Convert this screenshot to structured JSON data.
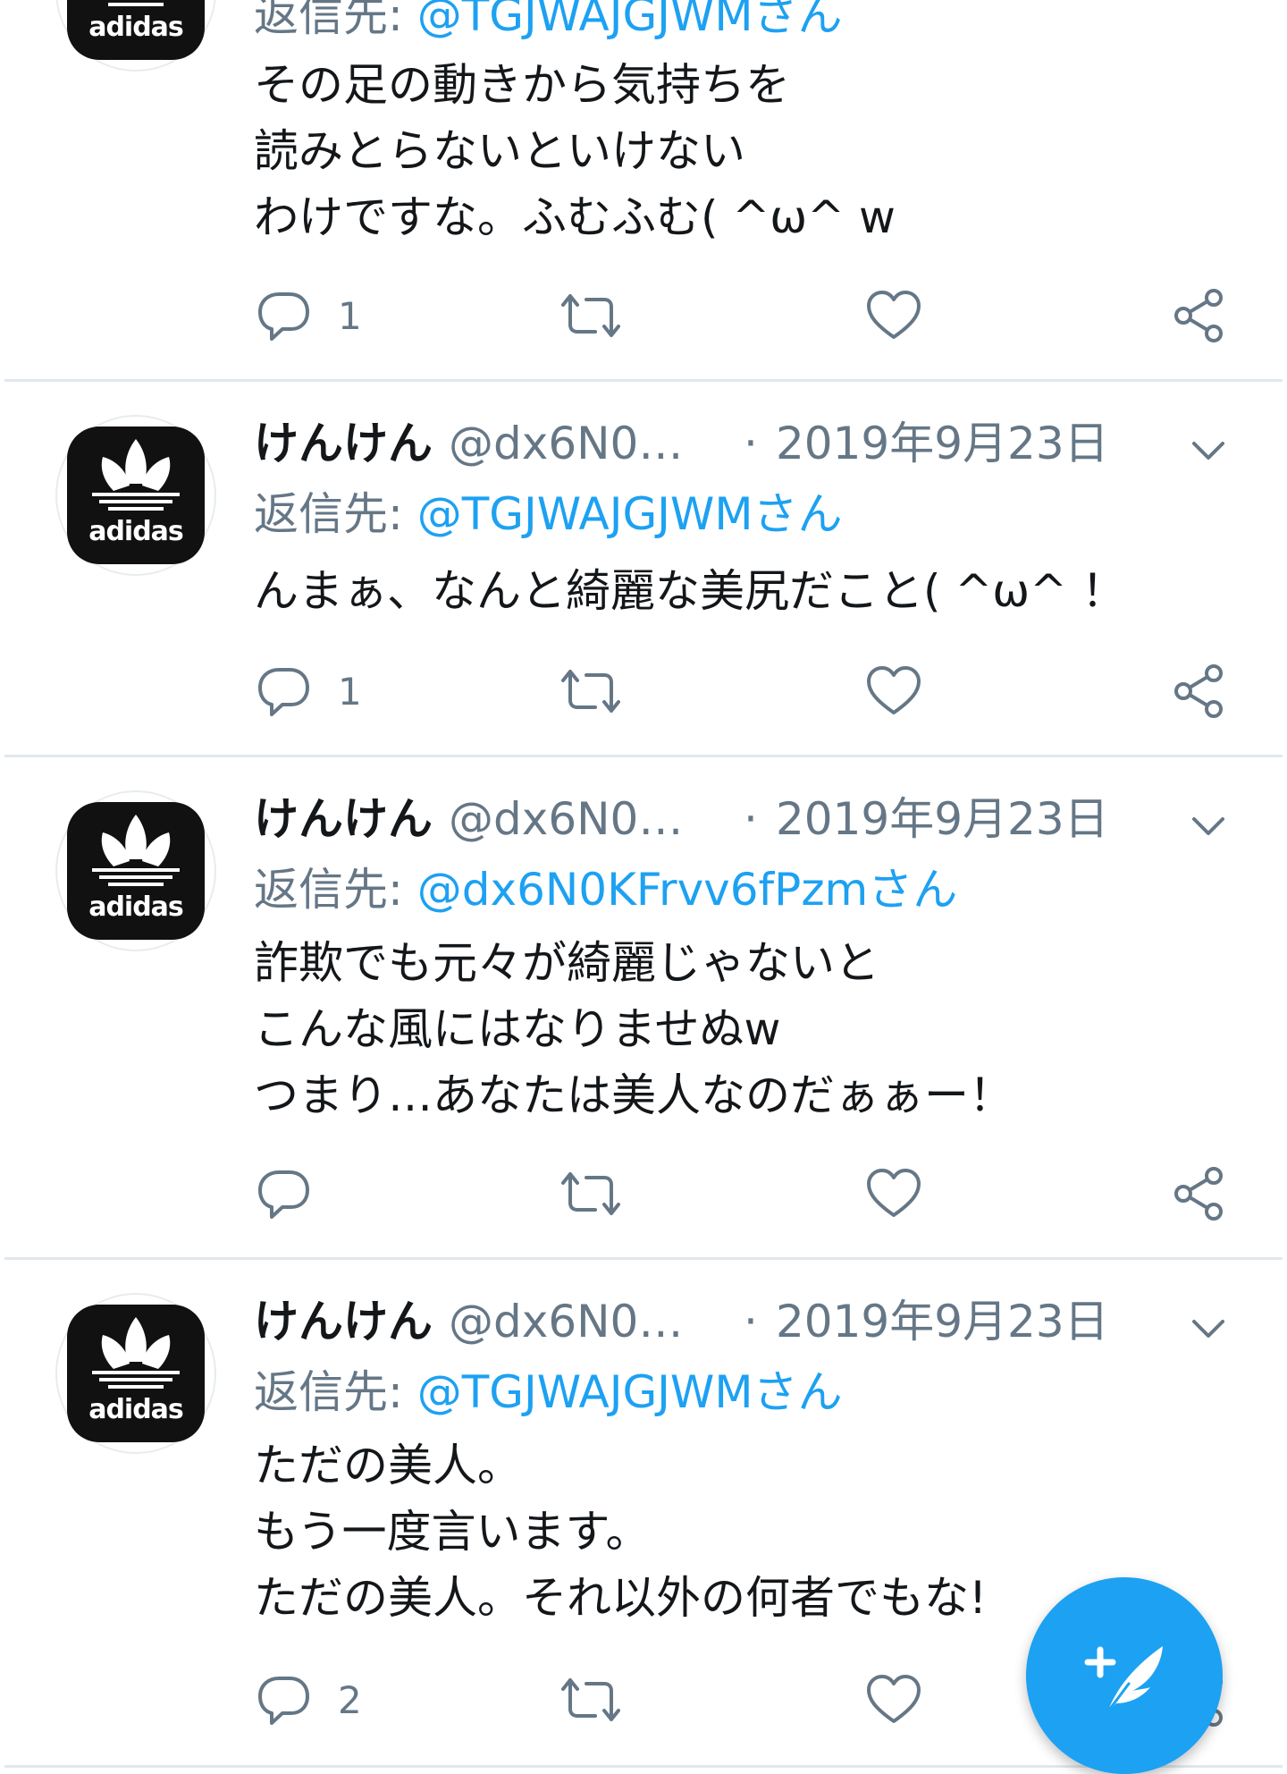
{
  "tweets": [
    {
      "name": "",
      "handle": "",
      "date": "",
      "reply_prefix": "返信先: ",
      "reply_to": "@TGJWAJGJWMさん",
      "lines": [
        "その足の動きから気持ちを",
        "読みとらないといけない",
        "わけですな。ふむふむ( ^ω^ w"
      ],
      "reply_count": "1",
      "avatar_brand": "adidas"
    },
    {
      "name": "けんけん",
      "handle": "@dx6N0…",
      "date": "2019年9月23日",
      "reply_prefix": "返信先: ",
      "reply_to": "@TGJWAJGJWMさん",
      "lines": [
        "んまぁ、なんと綺麗な美尻だこと( ^ω^ ！"
      ],
      "reply_count": "1",
      "avatar_brand": "adidas"
    },
    {
      "name": "けんけん",
      "handle": "@dx6N0…",
      "date": "2019年9月23日",
      "reply_prefix": "返信先: ",
      "reply_to": "@dx6N0KFrvv6fPzmさん",
      "lines": [
        "詐欺でも元々が綺麗じゃないと",
        "こんな風にはなりませぬw",
        "つまり…あなたは美人なのだぁぁー！"
      ],
      "reply_count": "",
      "avatar_brand": "adidas"
    },
    {
      "name": "けんけん",
      "handle": "@dx6N0…",
      "date": "2019年9月23日",
      "reply_prefix": "返信先: ",
      "reply_to": "@TGJWAJGJWMさん",
      "lines": [
        "ただの美人。",
        "もう一度言います。",
        "ただの美人。それ以外の何者でもな!"
      ],
      "reply_count": "2",
      "avatar_brand": "adidas"
    }
  ],
  "separator": "·",
  "colors": {
    "link": "#1da1f2",
    "muted": "#657786",
    "text": "#14171a",
    "divider": "#e1e8ed",
    "fab": "#1da1f2"
  },
  "icons": [
    "reply-icon",
    "retweet-icon",
    "like-icon",
    "share-icon",
    "caret-down-icon",
    "compose-tweet-icon"
  ]
}
